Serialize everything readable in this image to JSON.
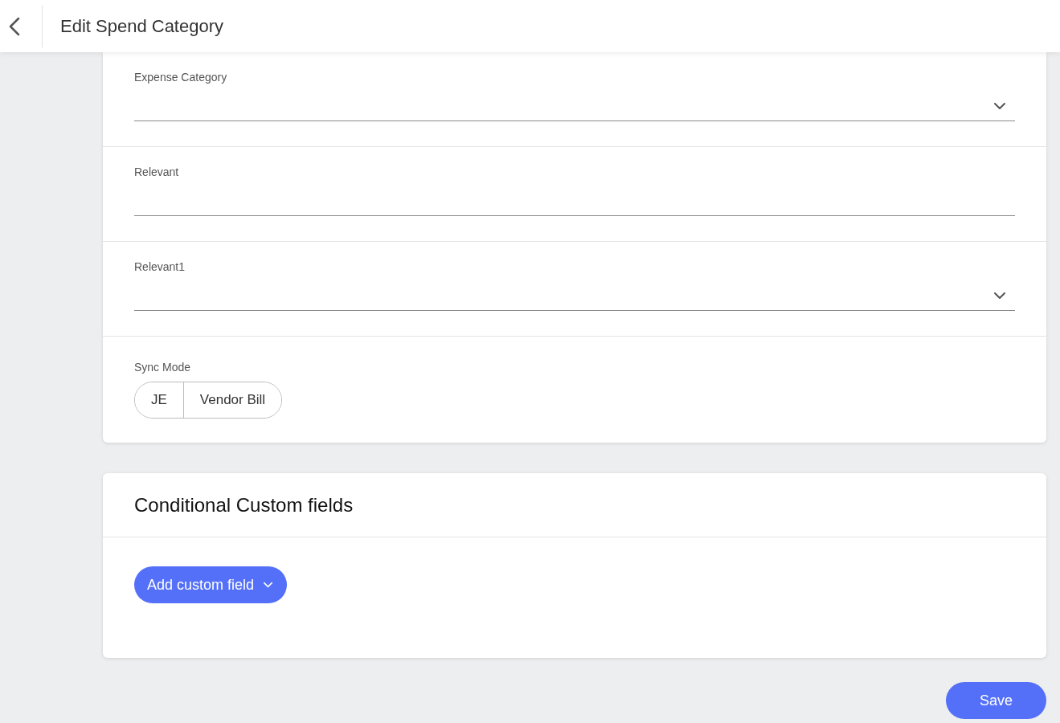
{
  "header": {
    "title": "Edit Spend Category"
  },
  "fields": [
    {
      "kind": "select",
      "label": "Expense Category"
    },
    {
      "kind": "text",
      "label": "Relevant"
    },
    {
      "kind": "select",
      "label": "Relevant1"
    }
  ],
  "sync_mode": {
    "label": "Sync Mode",
    "options": [
      {
        "label": "JE",
        "selected": false
      },
      {
        "label": "Vendor Bill",
        "selected": false
      }
    ]
  },
  "conditional_section": {
    "title": "Conditional Custom fields",
    "button": "Add custom field"
  },
  "save_button": "Save"
}
